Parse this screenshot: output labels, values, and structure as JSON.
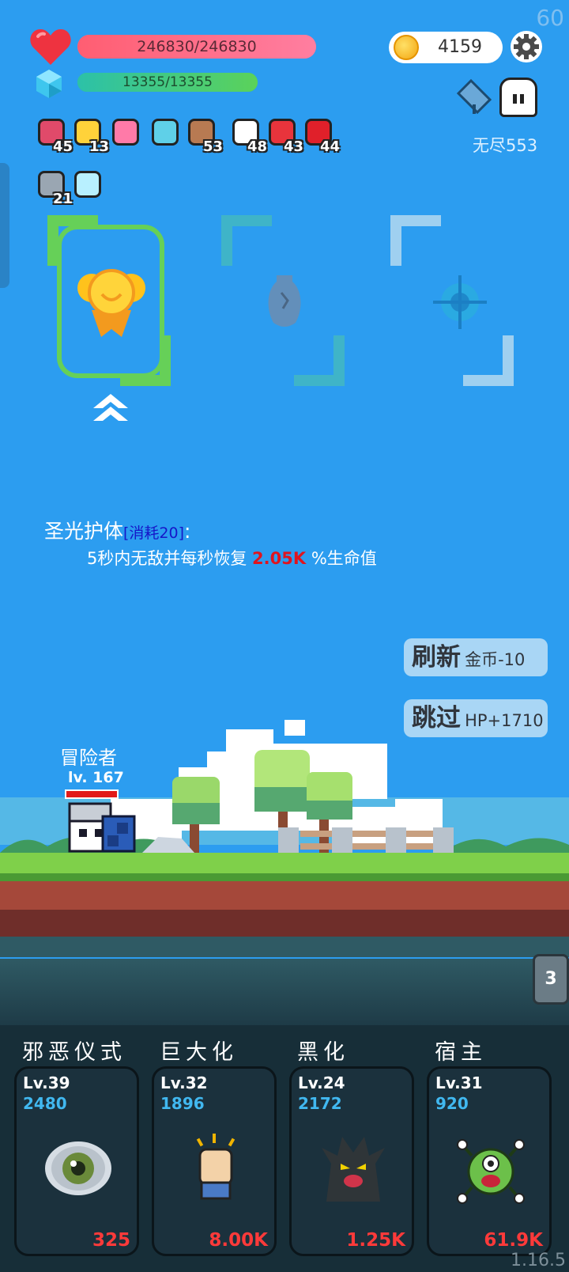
{
  "fps": "60",
  "player": {
    "hp_text": "246830/246830",
    "hp_fraction": 1.0,
    "mp_text": "13355/13355",
    "mp_fraction": 1.0,
    "name": "冒险者",
    "level": "lv. 167"
  },
  "gold": "4159",
  "endless": "无尽553",
  "items": [
    {
      "icon": "jam-jar-icon",
      "count": "45",
      "color": "#e04a6a"
    },
    {
      "icon": "crown-icon",
      "count": "13",
      "color": "#ffd23a"
    },
    {
      "icon": "love-letter-icon",
      "count": "",
      "color": "#ff7aa8"
    },
    {
      "icon": "magnifier-icon",
      "count": "",
      "color": "#5fd0e8"
    },
    {
      "icon": "donut-icon",
      "count": "53",
      "color": "#b87a52"
    },
    {
      "icon": "flower-icon",
      "count": "48",
      "color": "#ffffff"
    },
    {
      "icon": "sock-icon",
      "count": "43",
      "color": "#e8343c"
    },
    {
      "icon": "apple-icon",
      "count": "44",
      "color": "#e0202a"
    }
  ],
  "items2": [
    {
      "icon": "sword-icon",
      "count": "21",
      "color": "#9aa6b2"
    },
    {
      "icon": "sparkle-icon",
      "count": "",
      "color": "#b8f0ff"
    }
  ],
  "skill": {
    "title": "圣光护体",
    "cost": "[消耗20]",
    "colon": ":",
    "desc_prefix": "5秒内无敌并每秒恢复 ",
    "desc_value": "2.05K",
    "desc_suffix": " %生命值"
  },
  "buttons": {
    "refresh_big": "刷新",
    "refresh_small": "金币-10",
    "skip_big": "跳过",
    "skip_small": "HP+1710"
  },
  "tab_count": "3",
  "cards": [
    {
      "title": "邪恶仪式",
      "level": "Lv.39",
      "price": "2480",
      "value": "325",
      "icon": "eye-icon"
    },
    {
      "title": "巨大化",
      "level": "Lv.32",
      "price": "1896",
      "value": "8.00K",
      "icon": "fist-icon"
    },
    {
      "title": "黑化",
      "level": "Lv.24",
      "price": "2172",
      "value": "1.25K",
      "icon": "dark-tree-monster-icon"
    },
    {
      "title": "宿主",
      "level": "Lv.31",
      "price": "920",
      "value": "61.9K",
      "icon": "green-virus-monster-icon"
    }
  ],
  "version": "1.16.5",
  "colors": {
    "sky": "#2c9df0",
    "hp": "#ff6b80",
    "mp": "#5bd25a",
    "accent_green": "#66d058",
    "danger": "#ff3a3a"
  }
}
